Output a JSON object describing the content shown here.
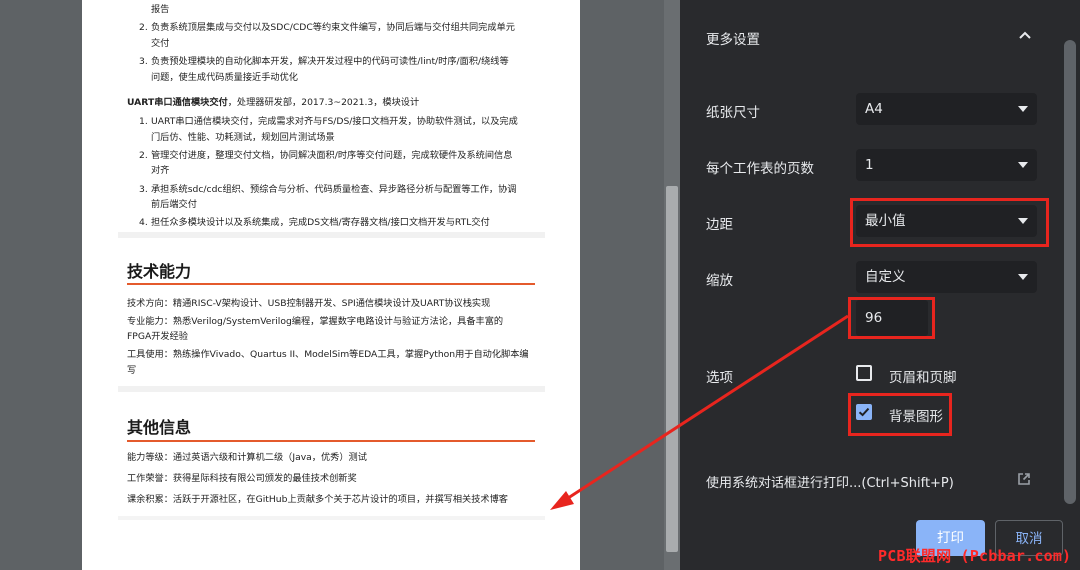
{
  "resume": {
    "top_cont": "报告",
    "item2": [
      "负责系统顶层集成与交付以及SDC/CDC等约束文件编写，协同后端与交付组共同完成单元",
      "交付"
    ],
    "item3": [
      "负责预处理模块的自动化脚本开发，解决开发过程中的代码可读性/lint/时序/面积/绕线等",
      "问题，使生成代码质量接近手动优化"
    ],
    "uart_title": "UART串口通信模块交付",
    "uart_meta": "，处理器研发部，2017.3~2021.3，模块设计",
    "uart_items": [
      [
        "UART串口通信模块交付，完成需求对齐与FS/DS/接口文档开发，协助软件测试，以及完成",
        "门后仿、性能、功耗测试，规划回片测试场景"
      ],
      [
        "管理交付进度，整理交付文档，协同解决面积/时序等交付问题，完成软硬件及系统间信息",
        "对齐"
      ],
      [
        "承担系统sdc/cdc组织、预综合与分析、代码质量检查、异步路径分析与配置等工作，协调",
        "前后端交付"
      ],
      [
        "担任众多模块设计以及系统集成，完成DS文档/寄存器文档/接口文档开发与RTL交付"
      ]
    ],
    "skills_heading": "技术能力",
    "skills": [
      "技术方向：精通RISC-V架构设计、USB控制器开发、SPI通信模块设计及UART协议栈实现",
      "专业能力：熟悉Verilog/SystemVerilog编程，掌握数字电路设计与验证方法论，具备丰富的",
      "FPGA开发经验",
      "工具使用：熟练操作Vivado、Quartus II、ModelSim等EDA工具，掌握Python用于自动化脚本编",
      "写"
    ],
    "other_heading": "其他信息",
    "other": [
      "能力等级：通过英语六级和计算机二级（Java，优秀）测试",
      "工作荣誉：获得星际科技有限公司颁发的最佳技术创新奖",
      "课余积累：活跃于开源社区，在GitHub上贡献多个关于芯片设计的项目，并撰写相关技术博客"
    ]
  },
  "settings": {
    "section_title": "更多设置",
    "paper_size_label": "纸张尺寸",
    "paper_size_value": "A4",
    "pages_per_sheet_label": "每个工作表的页数",
    "pages_per_sheet_value": "1",
    "margins_label": "边距",
    "margins_value": "最小值",
    "scale_label": "缩放",
    "scale_value": "自定义",
    "scale_custom": "96",
    "options_label": "选项",
    "headers_footers_label": "页眉和页脚",
    "headers_footers_checked": false,
    "background_graphics_label": "背景图形",
    "background_graphics_checked": true,
    "system_dialog_label": "使用系统对话框进行打印...(Ctrl+Shift+P)",
    "print_button": "打印",
    "cancel_button": "取消"
  },
  "colors": {
    "accent_blue": "#8ab4f8",
    "highlight_red": "#e8251e",
    "heading_rule": "#e45a2c"
  },
  "watermark": "PCB联盟网 (Pcbbar.com)"
}
